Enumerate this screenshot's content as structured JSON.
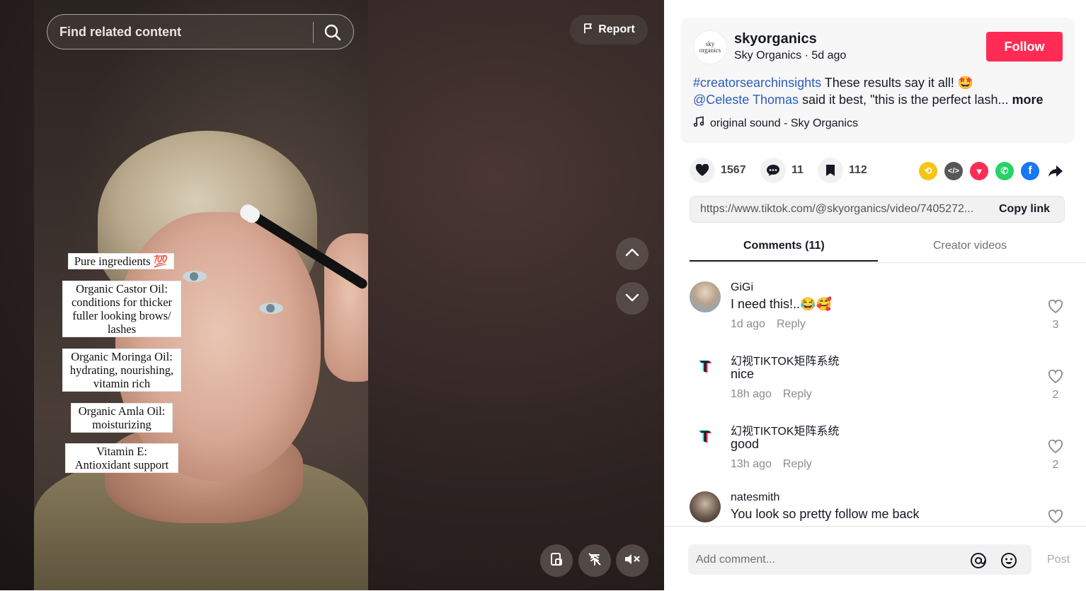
{
  "search": {
    "placeholder": "Find related content"
  },
  "report": {
    "label": "Report"
  },
  "overlay": {
    "items": [
      "Pure ingredients 💯",
      "Organic Castor Oil: conditions for thicker fuller looking brows/ lashes",
      "Organic Moringa Oil: hydrating, nourishing, vitamin rich",
      "Organic Amla Oil: moisturizing",
      "Vitamin E: Antioxidant support"
    ]
  },
  "author": {
    "avatar_text": "sky organics",
    "username": "skyorganics",
    "display_name": "Sky Organics",
    "posted": "5d ago",
    "separator": " · ",
    "follow_label": "Follow"
  },
  "caption": {
    "hashtag": "#creatorsearchinsights",
    "text1": " These results say it all! 🤩",
    "mention": "@Celeste Thomas",
    "text2": " said it best, \"this is the perfect lash...",
    "more": " more"
  },
  "sound": {
    "label": "original sound - Sky Organics"
  },
  "stats": {
    "likes": "1567",
    "comments": "11",
    "saves": "112"
  },
  "link": {
    "url": "https://www.tiktok.com/@skyorganics/video/7405272...",
    "copy_label": "Copy link"
  },
  "tabs": {
    "comments": "Comments (11)",
    "creator_videos": "Creator videos"
  },
  "comments": [
    {
      "name": "GiGi",
      "text": "I need this!..😂🥰",
      "time": "1d ago",
      "reply": "Reply",
      "likes": "3"
    },
    {
      "name": "幻视TIKTOK矩阵系统",
      "text": "nice",
      "time": "18h ago",
      "reply": "Reply",
      "likes": "2"
    },
    {
      "name": "幻视TIKTOK矩阵系统",
      "text": "good",
      "time": "13h ago",
      "reply": "Reply",
      "likes": "2"
    },
    {
      "name": "natesmith",
      "text": "You look so pretty follow me back",
      "time": "",
      "reply": "",
      "likes": ""
    }
  ],
  "composer": {
    "placeholder": "Add comment...",
    "post_label": "Post"
  },
  "colors": {
    "accent": "#fe2c55",
    "link": "#2b5db9"
  }
}
